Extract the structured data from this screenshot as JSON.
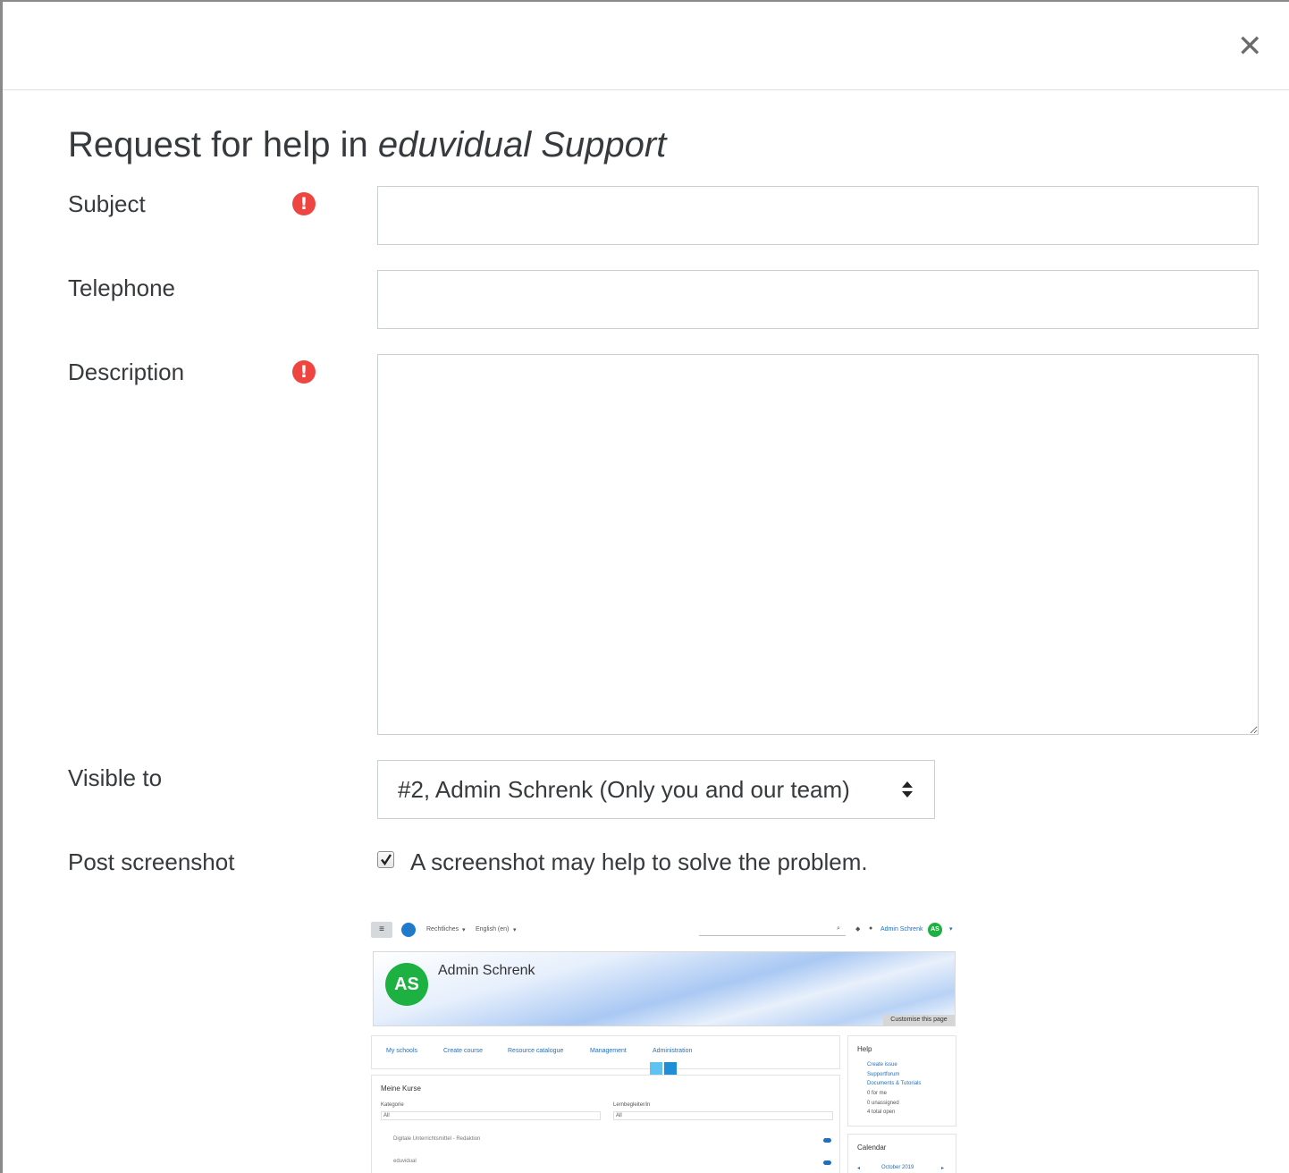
{
  "modal": {
    "close_symbol": "✕",
    "title_prefix": "Request for help in ",
    "title_emphasis": "eduvidual Support"
  },
  "form": {
    "subject": {
      "label": "Subject",
      "value": "",
      "required": true
    },
    "telephone": {
      "label": "Telephone",
      "value": ""
    },
    "description": {
      "label": "Description",
      "value": "",
      "required": true
    },
    "visible_to": {
      "label": "Visible to",
      "selected": "#2, Admin Schrenk (Only you and our team)"
    },
    "post_screenshot": {
      "label": "Post screenshot",
      "checked": true,
      "checkbox_label": "A screenshot may help to solve the problem."
    }
  },
  "colors": {
    "required_icon": "#ef4540",
    "link": "#1f6fc5",
    "avatar": "#1db141"
  },
  "screenshot_preview": {
    "topbar": {
      "menu_item_1": "Rechtliches",
      "menu_item_2": "English (en)",
      "user_name": "Admin Schrenk",
      "avatar_initials": "AS"
    },
    "banner": {
      "avatar_initials": "AS",
      "user_name": "Admin Schrenk",
      "customise_button": "Customise this page"
    },
    "nav_links": [
      "My schools",
      "Create course",
      "Resource catalogue",
      "Management",
      "Administration"
    ],
    "courses": {
      "heading": "Meine Kurse",
      "filter1_label": "Kategorie",
      "filter1_value": "All",
      "filter2_label": "Lernbegleiter/in",
      "filter2_value": "All",
      "rows": [
        "Digitale Unterrichtsmittel - Redaktion",
        "eduvidual"
      ]
    },
    "help_block": {
      "heading": "Help",
      "links": [
        "Create issue",
        "Supportforum",
        "Documents & Tutorials"
      ],
      "stats": [
        "0 for me",
        "0 unassigned",
        "4 total open"
      ]
    },
    "calendar_block": {
      "heading": "Calendar",
      "month": "October 2019"
    }
  }
}
